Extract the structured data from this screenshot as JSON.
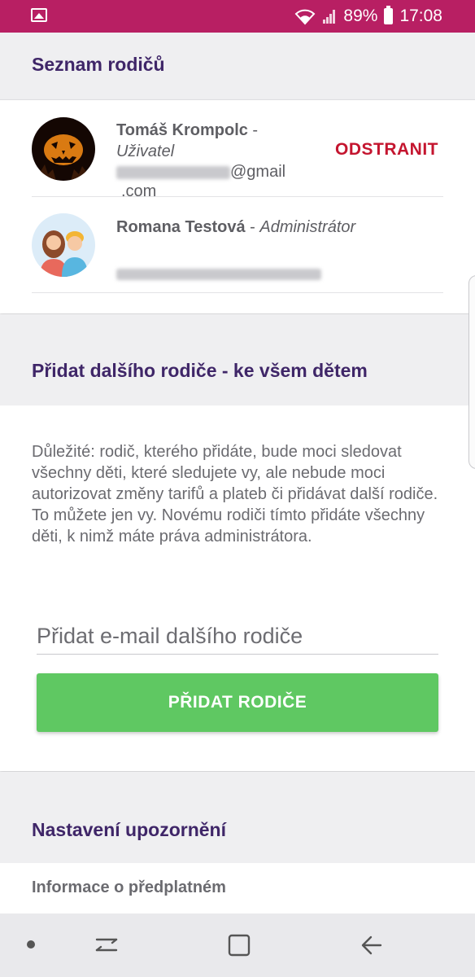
{
  "status_bar": {
    "battery": "89%",
    "time": "17:08",
    "icons": [
      "gallery-icon",
      "wifi-icon",
      "signal-icon",
      "battery-icon"
    ]
  },
  "parents_section": {
    "title": "Seznam rodičů",
    "parents": [
      {
        "name": "Tomáš Krompolc",
        "separator": " - ",
        "role": "Uživatel",
        "email_suffix": "@gmail",
        "email_tail": ".com",
        "action": "ODSTRANIT"
      },
      {
        "name": "Romana Testová",
        "separator": " - ",
        "role": "Administrátor"
      }
    ]
  },
  "add_parent_section": {
    "title": "Přidat dalšího rodiče - ke všem dětem",
    "info": "Důležité: rodič, kterého přidáte, bude moci sledovat všechny děti, které sledujete vy, ale nebude moci autorizovat změny tarifů a plateb či přidávat další rodiče. To můžete jen vy. Novému rodiči tímto přidáte všechny děti, k nimž máte práva administrátora.",
    "email_placeholder": "Přidat e-mail dalšího rodiče",
    "email_value": "",
    "button_label": "PŘIDAT RODIČE"
  },
  "notifications_section": {
    "title": "Nastavení upozornění",
    "items": [
      "Informace o předplatném"
    ]
  },
  "colors": {
    "status_bar": "#b81f63",
    "section_title": "#3f2668",
    "remove_action": "#c4152f",
    "add_button": "#5fc862"
  }
}
